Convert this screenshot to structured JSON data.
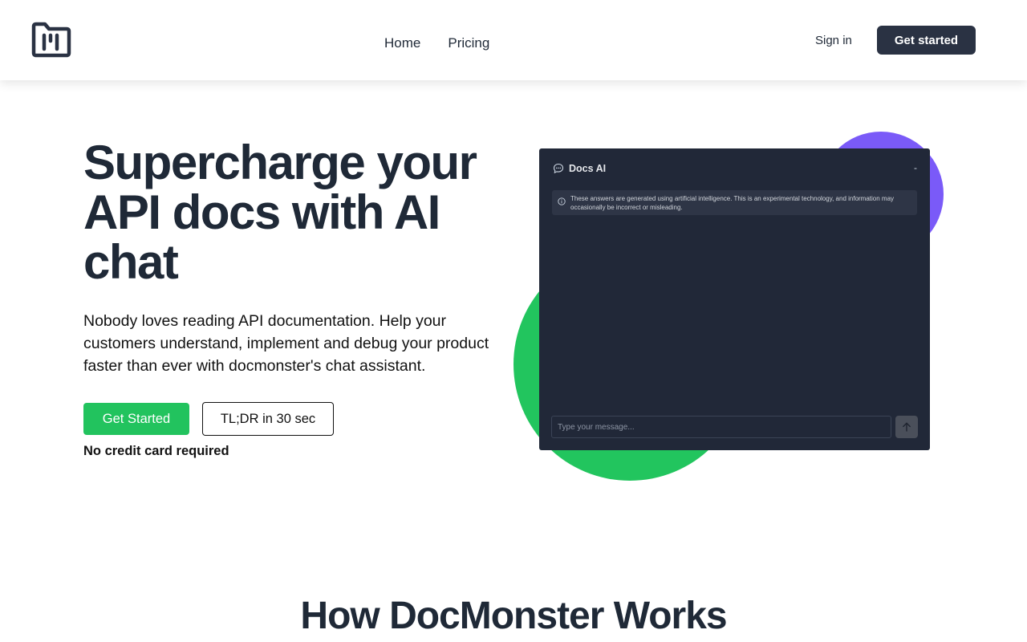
{
  "header": {
    "nav": [
      {
        "label": "Home"
      },
      {
        "label": "Pricing"
      }
    ],
    "signin_label": "Sign in",
    "cta_label": "Get started"
  },
  "hero": {
    "title": "Supercharge your API docs with AI chat",
    "description": "Nobody loves reading API documentation. Help your customers understand, implement and debug your product faster than ever with docmonster's chat assistant.",
    "primary_button": "Get Started",
    "secondary_button": "TL;DR in 30 sec",
    "note": "No credit card required"
  },
  "chat_widget": {
    "title": "Docs AI",
    "minimize_label": "-",
    "notice": "These answers are generated using artificial intelligence. This is an experimental technology, and information may occasionally be incorrect or misleading.",
    "input_placeholder": "Type your message..."
  },
  "section": {
    "title": "How DocMonster Works"
  },
  "colors": {
    "primary_green": "#22c35e",
    "accent_purple": "#7a5af8",
    "dark_button": "#2a3243",
    "chat_background": "#212838"
  },
  "icons": {
    "logo": "folder-logo-icon",
    "chat": "chat-bubble-icon",
    "info": "info-icon",
    "send": "arrow-up-icon"
  }
}
